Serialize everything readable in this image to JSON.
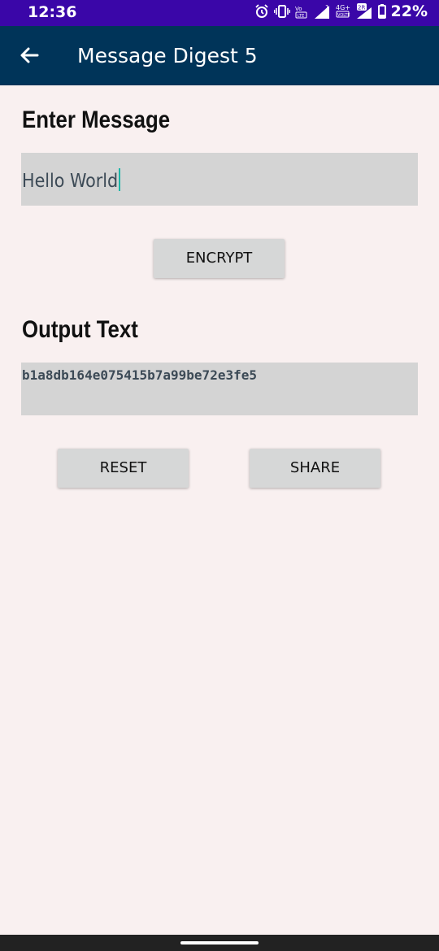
{
  "status_bar": {
    "time": "12:36",
    "battery": "22%",
    "icons": [
      "alarm-icon",
      "vibrate-icon",
      "volte-icon",
      "signal-icon",
      "4g-icon",
      "signal-icon-2",
      "battery-icon"
    ]
  },
  "app_bar": {
    "title": "Message Digest 5",
    "back_icon": "arrow-back-icon"
  },
  "input_section": {
    "heading": "Enter Message",
    "value": "Hello World"
  },
  "encrypt_button": {
    "label": "ENCRYPT"
  },
  "output_section": {
    "heading": "Output Text",
    "value": "b1a8db164e075415b7a99be72e3fe5"
  },
  "reset_button": {
    "label": "RESET"
  },
  "share_button": {
    "label": "SHARE"
  },
  "colors": {
    "status_bar": "#3a06a8",
    "app_bar": "#003459",
    "background": "#f9f0f0",
    "field": "#d4d4d4",
    "button": "#d6d7d7",
    "caret": "#1db6a8"
  }
}
